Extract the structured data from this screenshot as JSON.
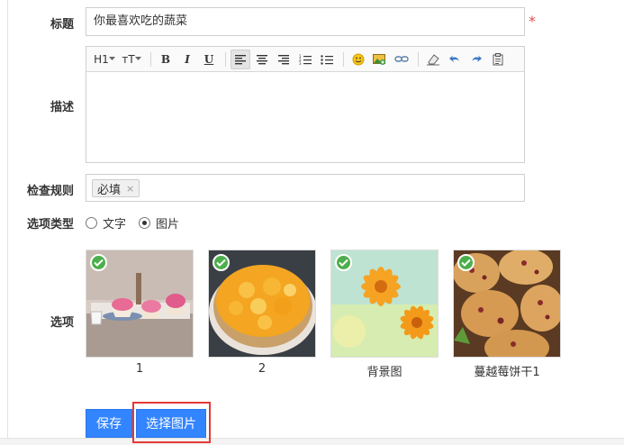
{
  "form": {
    "title_label": "标题",
    "title_value": "你最喜欢吃的蔬菜",
    "required_mark": "*",
    "desc_label": "描述",
    "rule_label": "检查规则",
    "rule_tag": "必填",
    "rule_tag_remove": "×",
    "type_label": "选项类型",
    "type_options": [
      {
        "label": "文字",
        "selected": false
      },
      {
        "label": "图片",
        "selected": true
      }
    ],
    "options_label": "选项",
    "options": [
      {
        "label": "1"
      },
      {
        "label": "2"
      },
      {
        "label": "背景图"
      },
      {
        "label": "蔓越莓饼干1"
      }
    ]
  },
  "toolbar": {
    "heading": "H1",
    "font_size": "тT",
    "bold": "B",
    "italic": "I",
    "underline": "U"
  },
  "actions": {
    "save_label": "保存",
    "choose_image_label": "选择图片"
  },
  "colors": {
    "primary": "#3385ff",
    "required": "#d9534f",
    "check": "#4cae4c",
    "highlight": "#e53935"
  }
}
